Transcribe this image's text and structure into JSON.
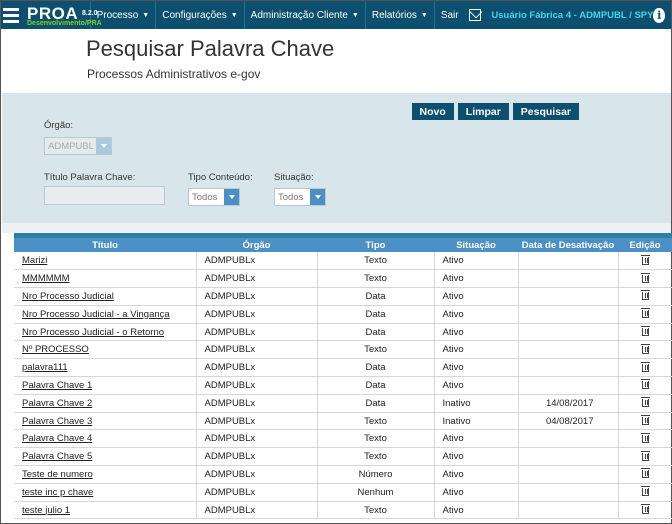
{
  "app": {
    "name": "PROA",
    "version": "8.2.0",
    "environment": "Desenvolvimento/PRA"
  },
  "nav": {
    "items": [
      {
        "label": "Processo"
      },
      {
        "label": "Configurações"
      },
      {
        "label": "Administração Cliente"
      },
      {
        "label": "Relatórios"
      },
      {
        "label": "Sair"
      }
    ],
    "user": "Usuário Fábrica 4 - ADMPUBL / SPY",
    "info_glyph": "i"
  },
  "page": {
    "title": "Pesquisar Palavra Chave",
    "subtitle": "Processos Administrativos e-gov"
  },
  "filters": {
    "orgao_label": "Órgão:",
    "orgao_value": "ADMPUBL",
    "titulo_label": "Título Palavra Chave:",
    "titulo_value": "",
    "tipo_label": "Tipo Conteúdo:",
    "tipo_value": "Todos",
    "situacao_label": "Situação:",
    "situacao_value": "Todos",
    "buttons": {
      "novo": "Novo",
      "limpar": "Limpar",
      "pesquisar": "Pesquisar"
    }
  },
  "table": {
    "headers": {
      "titulo": "Título",
      "orgao": "Órgão",
      "tipo": "Tipo",
      "situacao": "Situação",
      "data": "Data de Desativação",
      "edicao": "Edição"
    },
    "rows": [
      {
        "titulo": "Marizi",
        "orgao": "ADMPUBLx",
        "tipo": "Texto",
        "situacao": "Ativo",
        "data": ""
      },
      {
        "titulo": "MMMMMM",
        "orgao": "ADMPUBLx",
        "tipo": "Texto",
        "situacao": "Ativo",
        "data": ""
      },
      {
        "titulo": "Nro Processo Judicial",
        "orgao": "ADMPUBLx",
        "tipo": "Data",
        "situacao": "Ativo",
        "data": ""
      },
      {
        "titulo": "Nro Processo Judicial - a Vingança",
        "orgao": "ADMPUBLx",
        "tipo": "Data",
        "situacao": "Ativo",
        "data": ""
      },
      {
        "titulo": "Nro Processo Judicial - o Retorno",
        "orgao": "ADMPUBLx",
        "tipo": "Data",
        "situacao": "Ativo",
        "data": ""
      },
      {
        "titulo": "Nº PROCESSO",
        "orgao": "ADMPUBLx",
        "tipo": "Texto",
        "situacao": "Ativo",
        "data": ""
      },
      {
        "titulo": "palavra111",
        "orgao": "ADMPUBLx",
        "tipo": "Data",
        "situacao": "Ativo",
        "data": ""
      },
      {
        "titulo": "Palavra Chave 1",
        "orgao": "ADMPUBLx",
        "tipo": "Data",
        "situacao": "Ativo",
        "data": ""
      },
      {
        "titulo": "Palavra Chave 2",
        "orgao": "ADMPUBLx",
        "tipo": "Data",
        "situacao": "Inativo",
        "data": "14/08/2017"
      },
      {
        "titulo": "Palavra Chave 3",
        "orgao": "ADMPUBLx",
        "tipo": "Texto",
        "situacao": "Inativo",
        "data": "04/08/2017"
      },
      {
        "titulo": "Palavra Chave 4",
        "orgao": "ADMPUBLx",
        "tipo": "Texto",
        "situacao": "Ativo",
        "data": ""
      },
      {
        "titulo": "Palavra Chave 5",
        "orgao": "ADMPUBLx",
        "tipo": "Texto",
        "situacao": "Ativo",
        "data": ""
      },
      {
        "titulo": "Teste de numero",
        "orgao": "ADMPUBLx",
        "tipo": "Número",
        "situacao": "Ativo",
        "data": ""
      },
      {
        "titulo": "teste inc p chave",
        "orgao": "ADMPUBLx",
        "tipo": "Nenhum",
        "situacao": "Ativo",
        "data": ""
      },
      {
        "titulo": "teste julio 1",
        "orgao": "ADMPUBLx",
        "tipo": "Texto",
        "situacao": "Ativo",
        "data": ""
      }
    ]
  },
  "icons": {
    "menu": "hamburger-icon",
    "mail": "mail-icon",
    "info": "info-icon",
    "delete": "trash-icon",
    "dropdown": "chevron-down-icon"
  },
  "colors": {
    "nav_bg": "#0c4f6e",
    "header_bg": "#4a90c4",
    "panel_bg": "#d8e6ec",
    "env_green": "#7ed321",
    "user_cyan": "#3fd6f0"
  }
}
